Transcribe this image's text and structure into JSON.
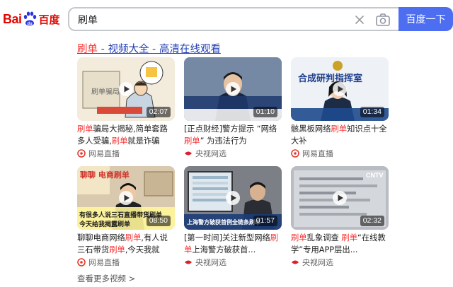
{
  "logo": {
    "bai": "Bai",
    "du": "du",
    "cn": "百度"
  },
  "search": {
    "query": "刷单",
    "button_label": "百度一下"
  },
  "result": {
    "title_highlight": "刷单",
    "title_rest": " - 视频大全 - 高清在线观看",
    "videos": [
      {
        "duration": "02:07",
        "caption_hl": "刷单",
        "caption_a": "骗局大揭秘,简单套路多人受骗,",
        "caption_hl2": "刷单",
        "caption_b": "就是诈骗",
        "source": "网易直播",
        "thumb_text": "刷单骗局"
      },
      {
        "duration": "01:10",
        "caption_a": "[正点财经]警方提示 “网络",
        "caption_hl": "刷单",
        "caption_b": "” 为违法行为",
        "source": "央视网选"
      },
      {
        "duration": "01:34",
        "caption_a": "骸黑板网络",
        "caption_hl": "刷单",
        "caption_b": "知识点十全大补",
        "source": "网易直播",
        "thumb_text": "合成研判指挥室"
      },
      {
        "duration": "08:50",
        "caption_a": "聊聊电商网络",
        "caption_hl": "刷单",
        "caption_b": ",有人说三石带货",
        "caption_hl2": "刷单",
        "caption_c": ",今天我就给...",
        "source": "网易直播",
        "thumb_text_top": "聊聊 电商刷单",
        "thumb_text_bottom": "有很多人说三石直播带货刷单 今天给我揭露刷单"
      },
      {
        "duration": "01:57",
        "caption_a": "[第一时间]关注新型网络",
        "caption_hl": "刷单",
        "caption_b": "上海警方破获首...",
        "source": "央视网选",
        "thumb_text": "上海警方破获首例全链条刷单"
      },
      {
        "duration": "02:32",
        "caption_hl": "刷单",
        "caption_a": "乱象调查 ",
        "caption_hl2": "刷单",
        "caption_b": "“在线教学”专用APP层出...",
        "source": "央视网选",
        "thumb_text": "CNTV"
      }
    ]
  },
  "more_link": "查看更多视频 >"
}
